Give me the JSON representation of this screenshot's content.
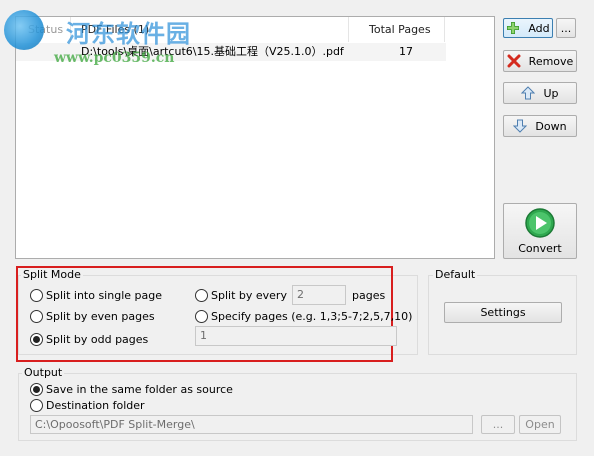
{
  "file_list": {
    "columns": [
      "Status",
      "PDF Files (1)",
      "Total Pages"
    ],
    "rows": [
      {
        "status": "",
        "file": "D:\\tools\\桌面\\artcut6\\15.基础工程（V25.1.0）.pdf",
        "pages": "17"
      }
    ]
  },
  "watermark": {
    "title": "河东软件园",
    "url": "www.pc0359.cn"
  },
  "buttons": {
    "add": "Add",
    "more": "...",
    "remove": "Remove",
    "up": "Up",
    "down": "Down",
    "convert": "Convert",
    "settings": "Settings",
    "browse": "...",
    "open": "Open"
  },
  "split_mode": {
    "label": "Split Mode",
    "single": "Split into single page",
    "even": "Split by even pages",
    "odd": "Split by odd pages",
    "every": "Split by every",
    "every_value": "2",
    "every_unit": "pages",
    "specify": "Specify pages (e.g. 1,3;5-7;2,5,7,10)",
    "specify_value": "1",
    "selected": "odd"
  },
  "default": {
    "label": "Default"
  },
  "output": {
    "label": "Output",
    "same_folder": "Save in the same folder as source",
    "destination": "Destination folder",
    "path": "C:\\Opoosoft\\PDF Split-Merge\\",
    "selected": "same_folder"
  },
  "colors": {
    "highlight": "#d81e1e",
    "accent": "#3c7fb1"
  }
}
